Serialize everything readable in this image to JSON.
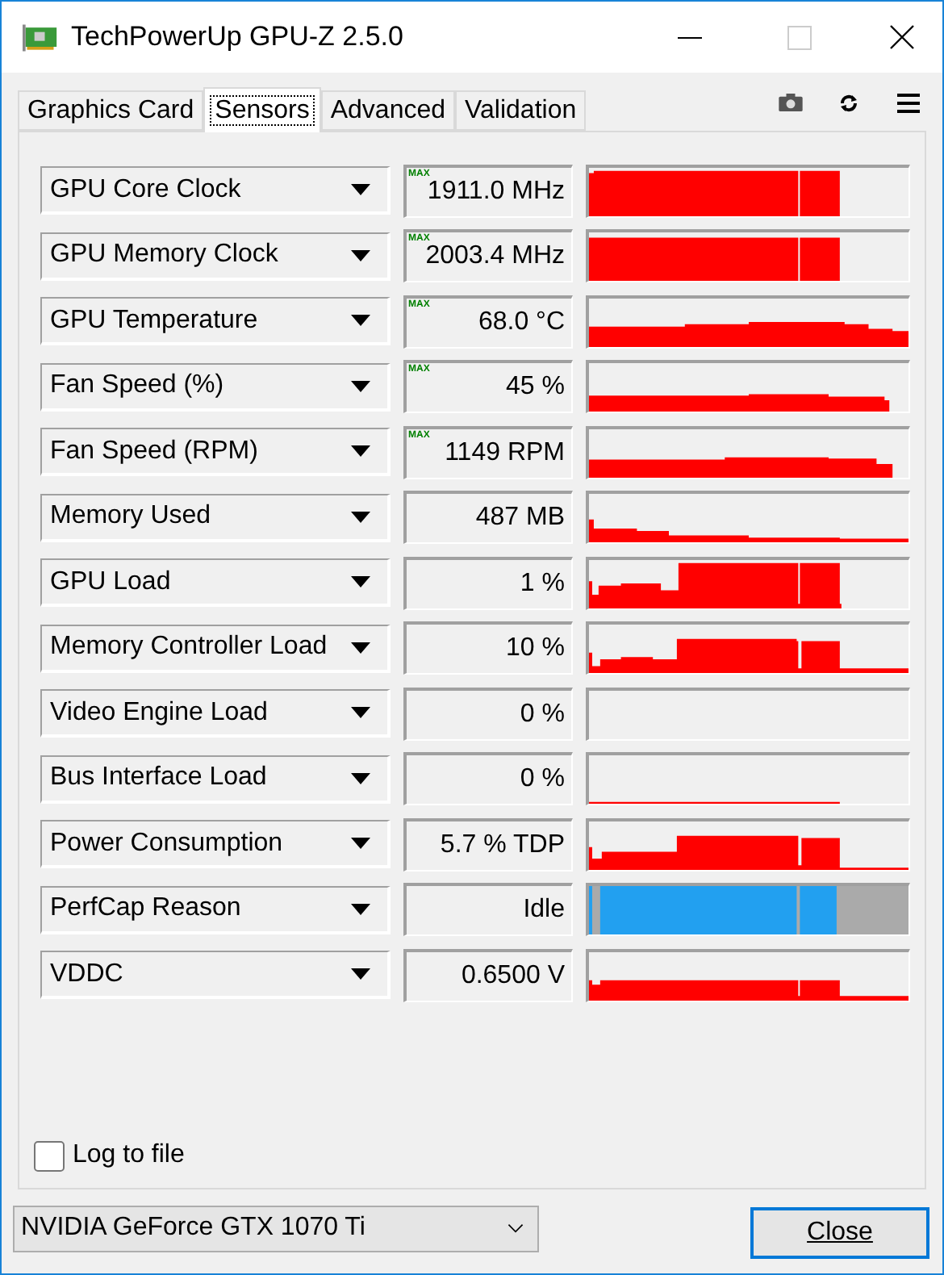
{
  "window": {
    "title": "TechPowerUp GPU-Z 2.5.0"
  },
  "tabs": [
    {
      "label": "Graphics Card",
      "selected": false
    },
    {
      "label": "Sensors",
      "selected": true
    },
    {
      "label": "Advanced",
      "selected": false
    },
    {
      "label": "Validation",
      "selected": false
    }
  ],
  "sensors": [
    {
      "name": "GPU Core Clock",
      "max_label": "MAX",
      "value": "1911.0 MHz",
      "kind": "load"
    },
    {
      "name": "GPU Memory Clock",
      "max_label": "MAX",
      "value": "2003.4 MHz",
      "kind": "load"
    },
    {
      "name": "GPU Temperature",
      "max_label": "MAX",
      "value": "68.0 °C",
      "kind": "load"
    },
    {
      "name": "Fan Speed (%)",
      "max_label": "MAX",
      "value": "45 %",
      "kind": "load"
    },
    {
      "name": "Fan Speed (RPM)",
      "max_label": "MAX",
      "value": "1149 RPM",
      "kind": "load"
    },
    {
      "name": "Memory Used",
      "value": "487 MB",
      "kind": "load"
    },
    {
      "name": "GPU Load",
      "value": "1 %",
      "kind": "load"
    },
    {
      "name": "Memory Controller Load",
      "value": "10 %",
      "kind": "load"
    },
    {
      "name": "Video Engine Load",
      "value": "0 %",
      "kind": "load"
    },
    {
      "name": "Bus Interface Load",
      "value": "0 %",
      "kind": "load"
    },
    {
      "name": "Power Consumption",
      "value": "5.7 % TDP",
      "kind": "load"
    },
    {
      "name": "PerfCap Reason",
      "value": "Idle",
      "kind": "reason"
    },
    {
      "name": "VDDC",
      "value": "0.6500 V",
      "kind": "load"
    }
  ],
  "log_to_file": {
    "label": "Log to file",
    "checked": false
  },
  "device_select": {
    "value": "NVIDIA GeForce GTX 1070 Ti"
  },
  "close_button": {
    "label": "Close"
  }
}
